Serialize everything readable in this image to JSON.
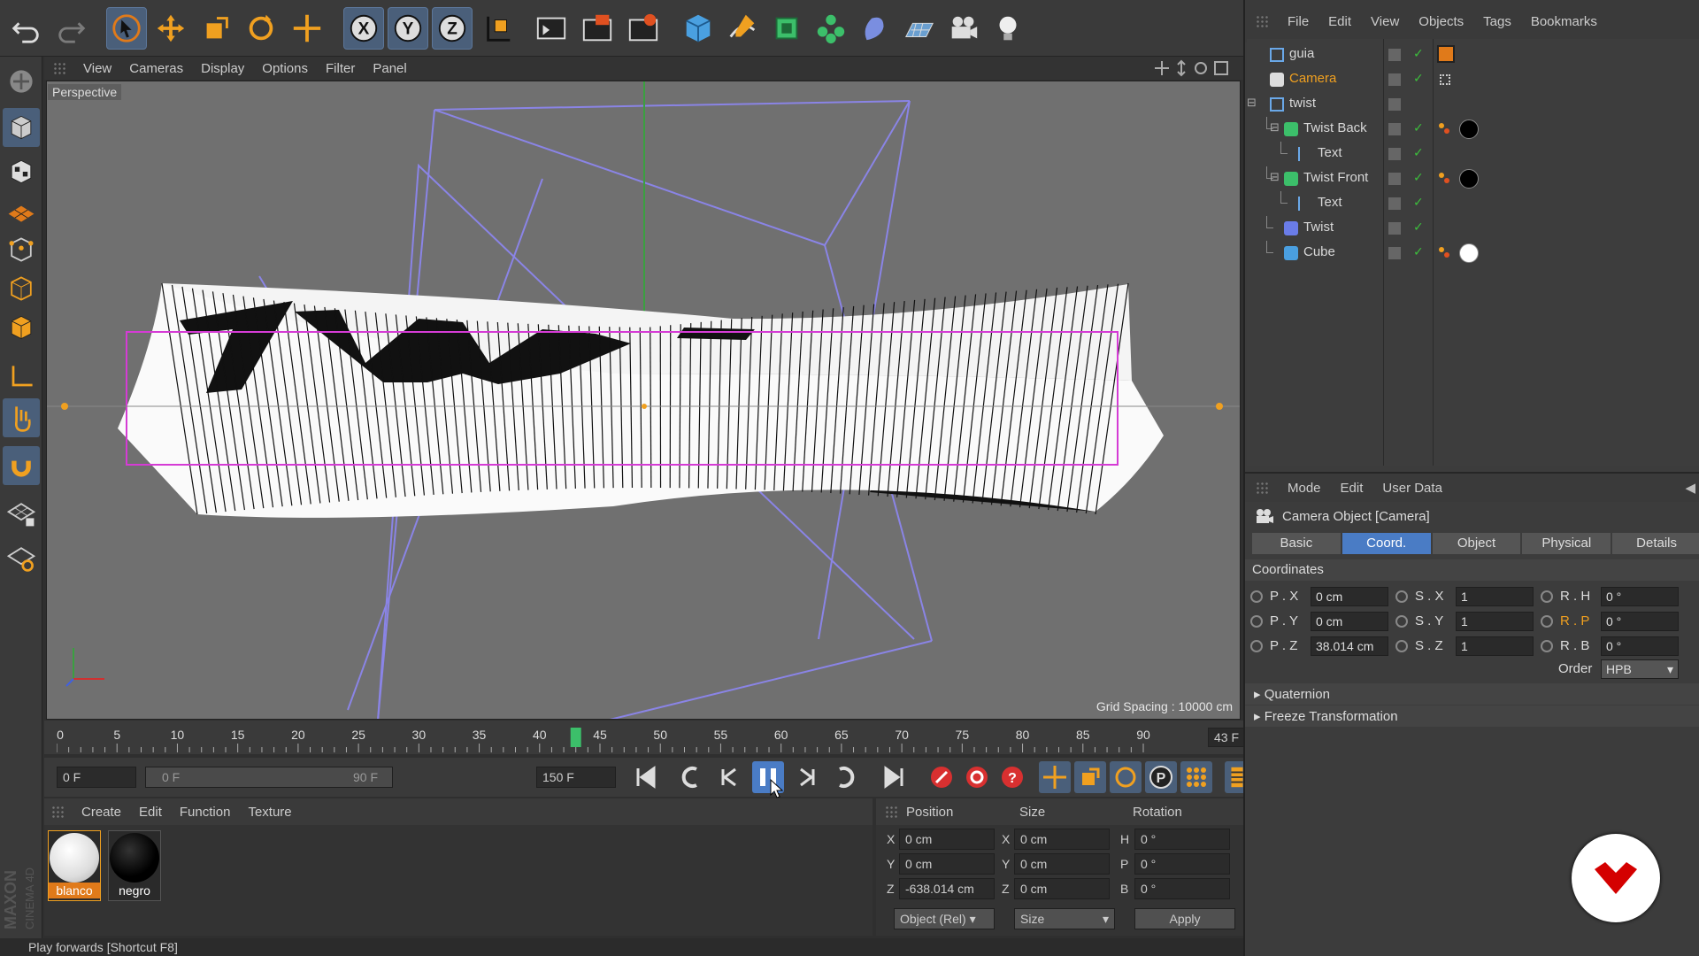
{
  "viewport": {
    "menu": [
      "View",
      "Cameras",
      "Display",
      "Options",
      "Filter",
      "Panel"
    ],
    "label": "Perspective",
    "grid_spacing": "Grid Spacing : 10000 cm"
  },
  "timeline": {
    "ticks": [
      "0",
      "5",
      "10",
      "15",
      "20",
      "25",
      "30",
      "35",
      "40",
      "45",
      "50",
      "55",
      "60",
      "65",
      "70",
      "75",
      "80",
      "85",
      "90"
    ],
    "current_frame": "43 F",
    "current_value": 43,
    "start_field": "0 F",
    "range_start": "0 F",
    "range_end": "90 F",
    "end_field": "150 F"
  },
  "materials": {
    "menu": [
      "Create",
      "Edit",
      "Function",
      "Texture"
    ],
    "items": [
      {
        "name": "blanco",
        "color": "#ffffff"
      },
      {
        "name": "negro",
        "color": "#000000"
      }
    ]
  },
  "coords": {
    "headers": [
      "Position",
      "Size",
      "Rotation"
    ],
    "rows": [
      {
        "a": "X",
        "pos": "0 cm",
        "b": "X",
        "size": "0 cm",
        "c": "H",
        "rot": "0 °"
      },
      {
        "a": "Y",
        "pos": "0 cm",
        "b": "Y",
        "size": "0 cm",
        "c": "P",
        "rot": "0 °"
      },
      {
        "a": "Z",
        "pos": "-638.014 cm",
        "b": "Z",
        "size": "0 cm",
        "c": "B",
        "rot": "0 °"
      }
    ],
    "mode": "Object (Rel)",
    "size_mode": "Size",
    "apply": "Apply"
  },
  "status": "Play forwards [Shortcut F8]",
  "brand": {
    "line1": "MAXON",
    "line2": "CINEMA 4D"
  },
  "object_manager": {
    "menu": [
      "File",
      "Edit",
      "View",
      "Objects",
      "Tags",
      "Bookmarks"
    ],
    "objects": [
      {
        "name": "guia",
        "indent": 0
      },
      {
        "name": "Camera",
        "indent": 0
      },
      {
        "name": "twist",
        "indent": 0
      },
      {
        "name": "Twist Back",
        "indent": 1
      },
      {
        "name": "Text",
        "indent": 2
      },
      {
        "name": "Twist Front",
        "indent": 1
      },
      {
        "name": "Text",
        "indent": 2
      },
      {
        "name": "Twist",
        "indent": 1
      },
      {
        "name": "Cube",
        "indent": 1
      }
    ]
  },
  "attributes": {
    "menu": [
      "Mode",
      "Edit",
      "User Data"
    ],
    "title": "Camera Object [Camera]",
    "tabs": [
      "Basic",
      "Coord.",
      "Object",
      "Physical",
      "Details"
    ],
    "active_tab": "Coord.",
    "section": "Coordinates",
    "rows": [
      {
        "pl": "P . X",
        "pv": "0 cm",
        "sl": "S . X",
        "sv": "1",
        "rl": "R . H",
        "rv": "0 °"
      },
      {
        "pl": "P . Y",
        "pv": "0 cm",
        "sl": "S . Y",
        "sv": "1",
        "rl": "R . P",
        "rv": "0 °"
      },
      {
        "pl": "P . Z",
        "pv": "38.014 cm",
        "sl": "S . Z",
        "sv": "1",
        "rl": "R . B",
        "rv": "0 °"
      }
    ],
    "order_label": "Order",
    "order_value": "HPB",
    "quaternion": "Quaternion",
    "freeze": "Freeze Transformation"
  },
  "colors": {
    "accent": "#4a7cc5",
    "camera_name": "#f0a020",
    "logo": "#d40000"
  }
}
